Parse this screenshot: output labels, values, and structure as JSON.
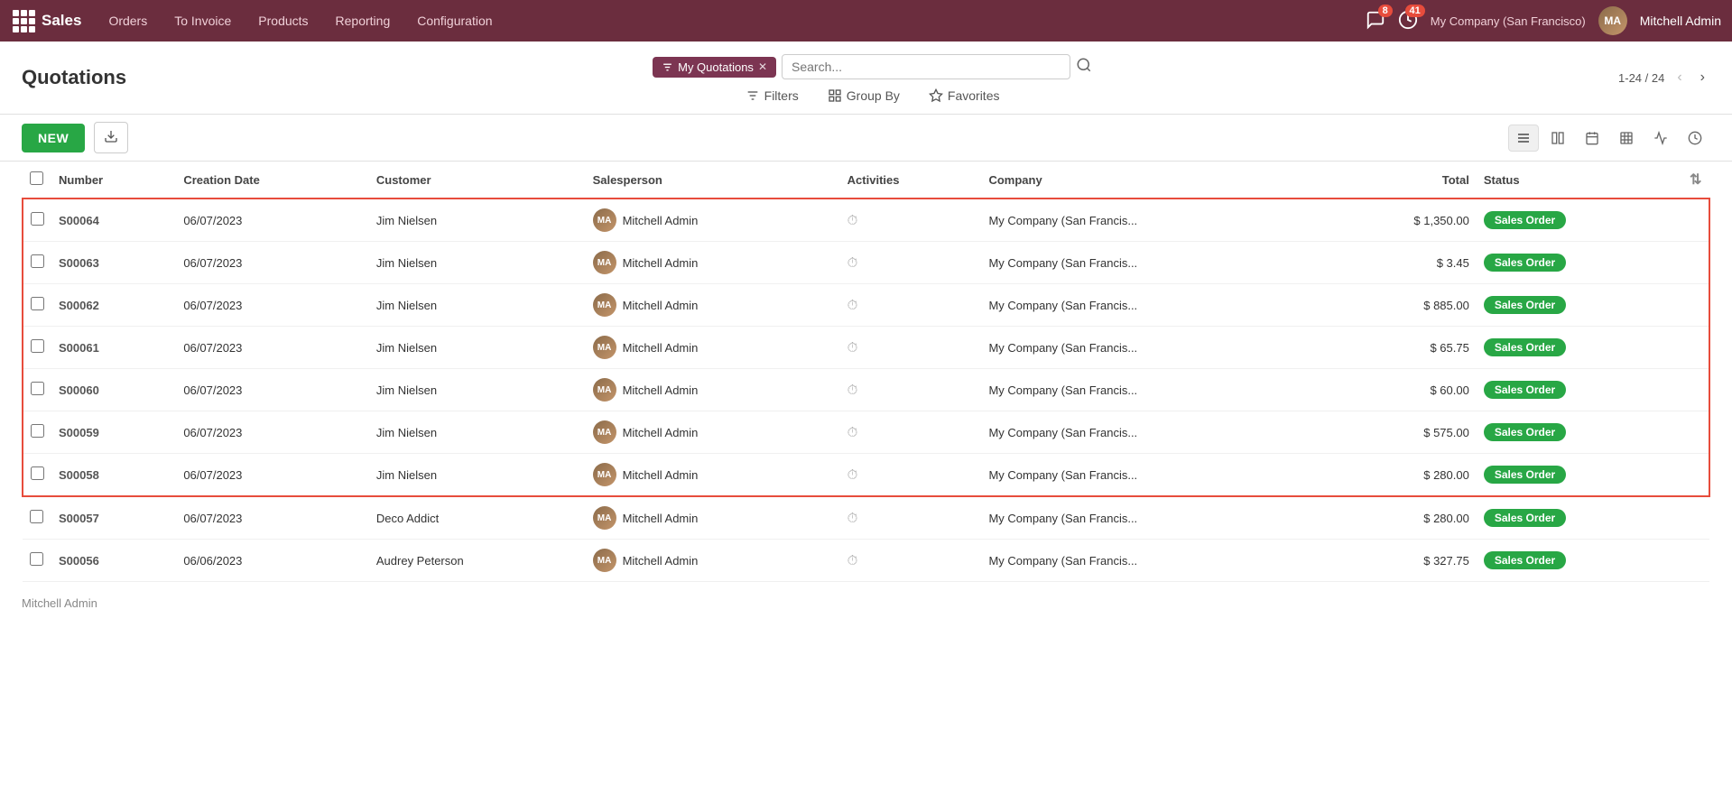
{
  "topnav": {
    "brand": "Sales",
    "menu_items": [
      "Orders",
      "To Invoice",
      "Products",
      "Reporting",
      "Configuration"
    ],
    "messages_count": "8",
    "activities_count": "41",
    "company": "My Company (San Francisco)",
    "user": "Mitchell Admin"
  },
  "page": {
    "title": "Quotations",
    "new_label": "NEW",
    "filter_tag": "My Quotations",
    "search_placeholder": "Search...",
    "pagination": "1-24 / 24"
  },
  "toolbar": {
    "filters_label": "Filters",
    "group_by_label": "Group By",
    "favorites_label": "Favorites"
  },
  "columns": {
    "number": "Number",
    "creation_date": "Creation Date",
    "customer": "Customer",
    "salesperson": "Salesperson",
    "activities": "Activities",
    "company": "Company",
    "total": "Total",
    "status": "Status"
  },
  "rows": [
    {
      "id": "S00064",
      "date": "06/07/2023",
      "customer": "Jim Nielsen",
      "salesperson": "Mitchell Admin",
      "company": "My Company (San Francis...",
      "total": "$ 1,350.00",
      "status": "Sales Order",
      "highlighted": true
    },
    {
      "id": "S00063",
      "date": "06/07/2023",
      "customer": "Jim Nielsen",
      "salesperson": "Mitchell Admin",
      "company": "My Company (San Francis...",
      "total": "$ 3.45",
      "status": "Sales Order",
      "highlighted": true
    },
    {
      "id": "S00062",
      "date": "06/07/2023",
      "customer": "Jim Nielsen",
      "salesperson": "Mitchell Admin",
      "company": "My Company (San Francis...",
      "total": "$ 885.00",
      "status": "Sales Order",
      "highlighted": true
    },
    {
      "id": "S00061",
      "date": "06/07/2023",
      "customer": "Jim Nielsen",
      "salesperson": "Mitchell Admin",
      "company": "My Company (San Francis...",
      "total": "$ 65.75",
      "status": "Sales Order",
      "highlighted": true
    },
    {
      "id": "S00060",
      "date": "06/07/2023",
      "customer": "Jim Nielsen",
      "salesperson": "Mitchell Admin",
      "company": "My Company (San Francis...",
      "total": "$ 60.00",
      "status": "Sales Order",
      "highlighted": true
    },
    {
      "id": "S00059",
      "date": "06/07/2023",
      "customer": "Jim Nielsen",
      "salesperson": "Mitchell Admin",
      "company": "My Company (San Francis...",
      "total": "$ 575.00",
      "status": "Sales Order",
      "highlighted": true
    },
    {
      "id": "S00058",
      "date": "06/07/2023",
      "customer": "Jim Nielsen",
      "salesperson": "Mitchell Admin",
      "company": "My Company (San Francis...",
      "total": "$ 280.00",
      "status": "Sales Order",
      "highlighted": true
    },
    {
      "id": "S00057",
      "date": "06/07/2023",
      "customer": "Deco Addict",
      "salesperson": "Mitchell Admin",
      "company": "My Company (San Francis...",
      "total": "$ 280.00",
      "status": "Sales Order",
      "highlighted": false
    },
    {
      "id": "S00056",
      "date": "06/06/2023",
      "customer": "Audrey Peterson",
      "salesperson": "Mitchell Admin",
      "company": "My Company (San Francis...",
      "total": "$ 327.75",
      "status": "Sales Order",
      "highlighted": false
    }
  ],
  "footer": {
    "salesperson_label": "Mitchell Admin"
  }
}
